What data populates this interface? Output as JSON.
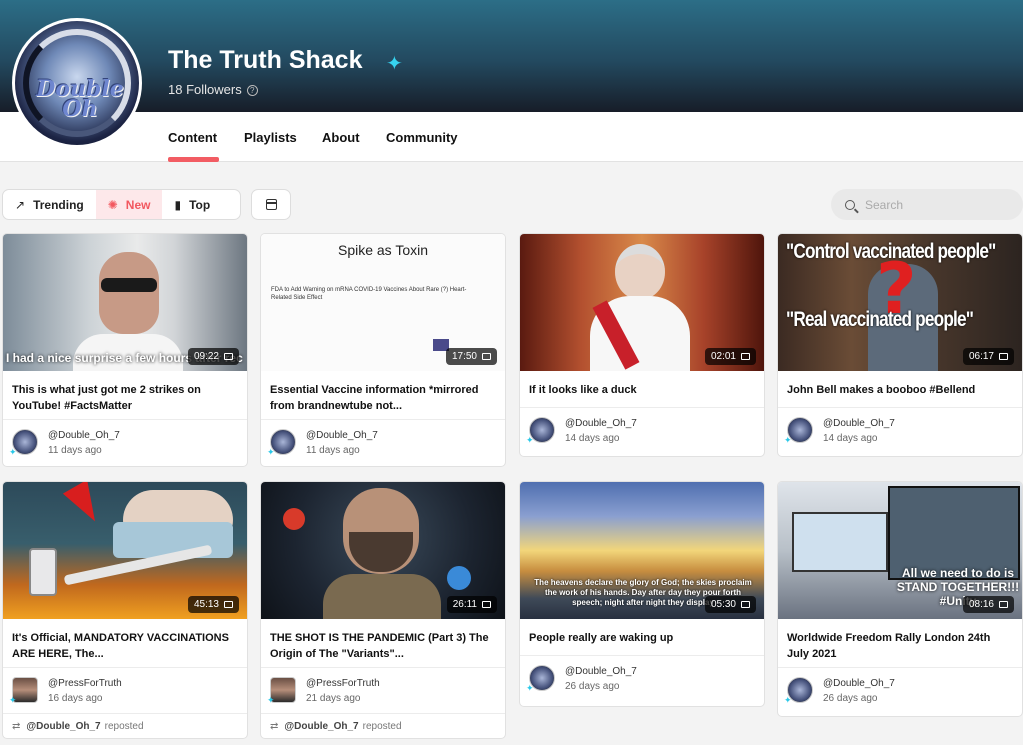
{
  "channel": {
    "name": "The Truth Shack",
    "followers": "18 Followers",
    "avatar_text": "Double Oh"
  },
  "tabs": [
    "Content",
    "Playlists",
    "About",
    "Community"
  ],
  "sort": {
    "trending": "Trending",
    "new": "New",
    "top": "Top"
  },
  "search": {
    "placeholder": "Search"
  },
  "videos": [
    {
      "title": "This is what just got me 2 strikes on YouTube! #FactsMatter",
      "duration": "09:22",
      "author": "@Double_Oh_7",
      "age": "11 days ago",
      "overlay": "I had a nice surprise a few hours after rec"
    },
    {
      "title": "Essential Vaccine information *mirrored from brandnewtube not...",
      "duration": "17:50",
      "author": "@Double_Oh_7",
      "age": "11 days ago",
      "overlay": "Spike as Toxin",
      "overlay2": "FDA to Add Warning on mRNA COVID-19 Vaccines About Rare (?) Heart-Related Side Effect"
    },
    {
      "title": "If it looks like a duck",
      "duration": "02:01",
      "author": "@Double_Oh_7",
      "age": "14 days ago"
    },
    {
      "title": "John Bell makes a booboo #Bellend",
      "duration": "06:17",
      "author": "@Double_Oh_7",
      "age": "14 days ago",
      "overlay": "\"Control vaccinated people\"",
      "overlay2": "\"Real vaccinated people\""
    },
    {
      "title": "It's Official, MANDATORY VACCINATIONS ARE HERE, The...",
      "duration": "45:13",
      "author": "@PressForTruth",
      "age": "16 days ago",
      "reposter": "@Double_Oh_7",
      "reposted": "reposted"
    },
    {
      "title": "THE SHOT IS THE PANDEMIC (Part 3) The Origin of The \"Variants\"...",
      "duration": "26:11",
      "author": "@PressForTruth",
      "age": "21 days ago",
      "reposter": "@Double_Oh_7",
      "reposted": "reposted"
    },
    {
      "title": "People really are waking up",
      "duration": "05:30",
      "author": "@Double_Oh_7",
      "age": "26 days ago",
      "overlay": "The heavens declare the glory of God; the skies proclaim the work of his hands. Day after day they pour forth speech; night after night they display"
    },
    {
      "title": "Worldwide Freedom Rally London 24th July 2021",
      "duration": "08:16",
      "author": "@Double_Oh_7",
      "age": "26 days ago",
      "overlay": "All we need to do is STAND TOGETHER!!! #Unity"
    }
  ]
}
